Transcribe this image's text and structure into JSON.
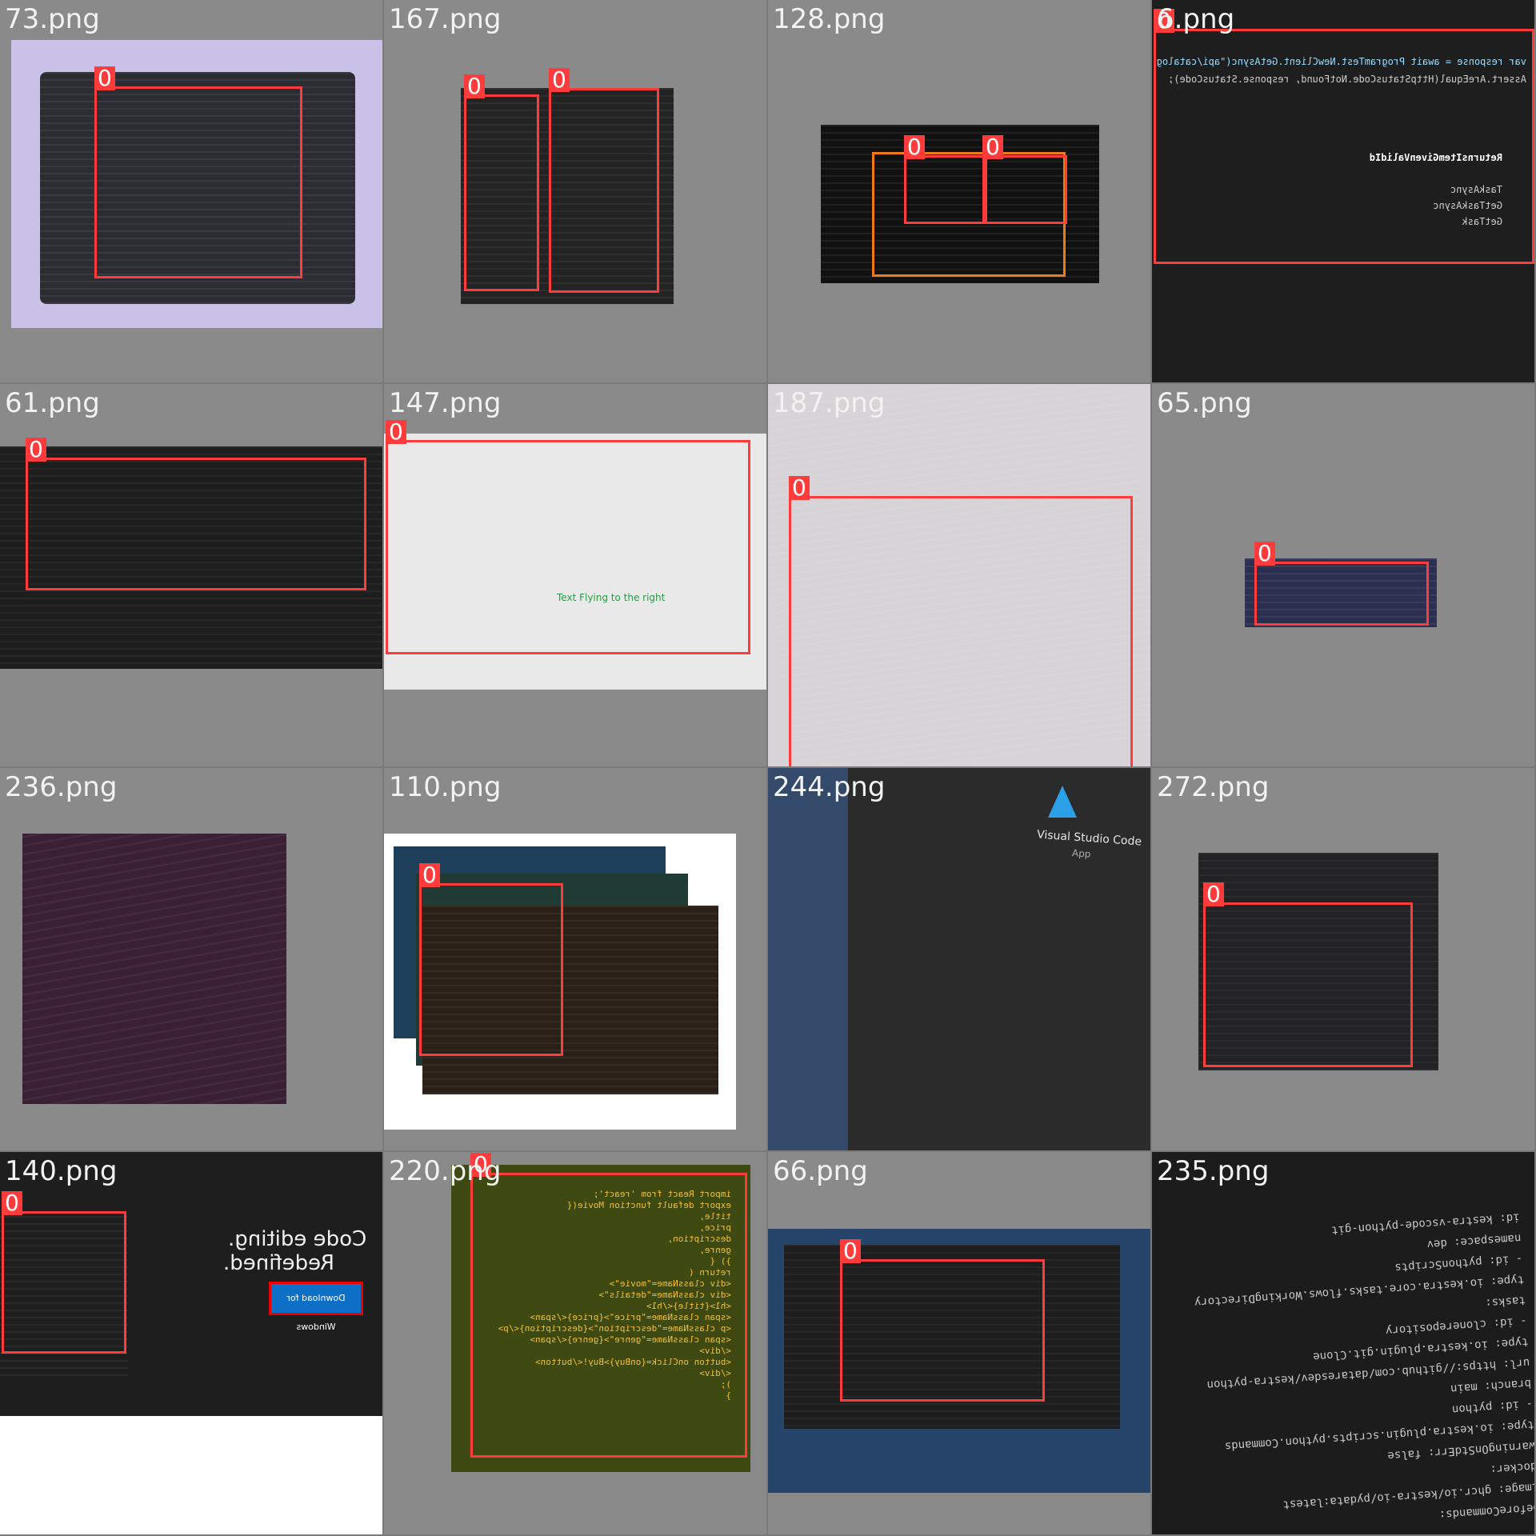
{
  "tiles": [
    {
      "label": "73.png",
      "tag": "0"
    },
    {
      "label": "167.png",
      "tag": "0",
      "tag2": "0"
    },
    {
      "label": "128.png",
      "tag": "0",
      "tag2": "0"
    },
    {
      "label": "6.png",
      "tag": "0",
      "lines": [
        "var response = await ProgramTest.NewClient.GetAsync(\"api/catalog",
        "Assert.AreEqual(HttpStatusCode.NotFound, response.StatusCode);",
        "ReturnsItemGivenValidId",
        "TaskAsync",
        "GetTaskAsync",
        "GetTask"
      ]
    },
    {
      "label": "61.png",
      "tag": "0"
    },
    {
      "label": "147.png",
      "tag": "0",
      "caption": "Text Flying to the right"
    },
    {
      "label": "187.png",
      "tag": "0"
    },
    {
      "label": "65.png",
      "tag": "0"
    },
    {
      "label": "236.png"
    },
    {
      "label": "110.png",
      "tag": "0"
    },
    {
      "label": "244.png",
      "title": "Visual Studio Code",
      "subtitle": "App"
    },
    {
      "label": "272.png",
      "tag": "0"
    },
    {
      "label": "140.png",
      "tag": "0",
      "headline1": "Code editing.",
      "headline2": "Redefined.",
      "download": "Download for Windows"
    },
    {
      "label": "220.png",
      "tag": "0",
      "code": [
        "import React from 'react';",
        "export default function Movie({",
        "title,",
        "price,",
        "description,",
        "genre,",
        "}) {",
        "return (",
        "<div className=\"movie\">",
        "<div className=\"details\">",
        "<h1>{title}</h1>",
        "<span className=\"price\">{price}</span>",
        "<p className=\"description\">{description}</p>",
        "<span className=\"genre\">{genre}</span>",
        "</div>",
        "<button onClick={onBuy}>Buy!</button>",
        "</div>",
        ");",
        "}"
      ]
    },
    {
      "label": "66.png",
      "tag": "0"
    },
    {
      "label": "235.png",
      "code": [
        "beforeCommands:",
        "image: ghcr.io/kestra-io/pydata:latest",
        "docker:",
        "warningOnStdErr: false",
        "type: io.kestra.plugin.scripts.python.Commands",
        "- id: python",
        "",
        "branch: main",
        "url: https://github.com/dataresdev/kestra-python",
        "type: io.kestra.plugin.git.Clone",
        "- id: clonerepository",
        "tasks:",
        "type: io.kestra.core.tasks.flows.WorkingDirectory",
        "- id: pythonScripts",
        "",
        "namespace: dev",
        "id: kestra-vscode-python-git"
      ]
    }
  ]
}
